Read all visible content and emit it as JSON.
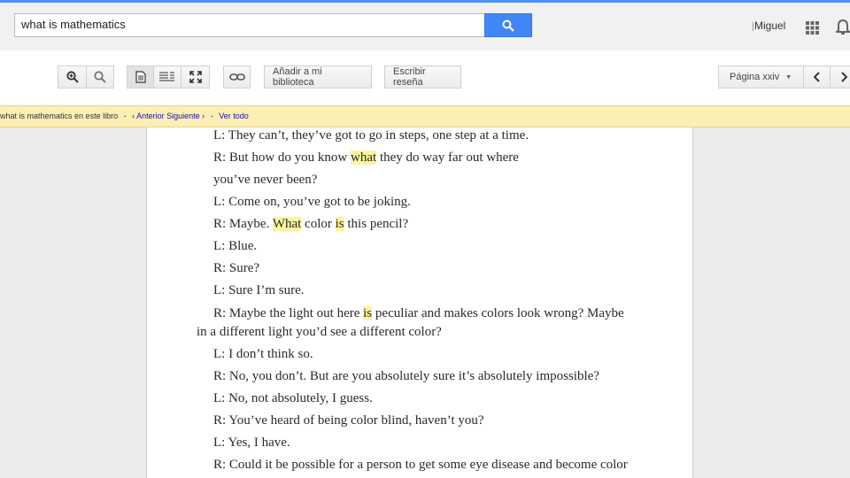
{
  "search": {
    "query": "what is mathematics"
  },
  "header": {
    "user_name": "Miguel"
  },
  "toolbar": {
    "add_library_label": "Añadir a mi biblioteca",
    "write_review_label": "Escribir reseña",
    "page_label": "Página xxiv"
  },
  "find_bar": {
    "query": "what is mathematics",
    "in_book": "en este libro",
    "dash": "-",
    "prev": "‹ Anterior",
    "next": "Siguiente ›",
    "view_all": "Ver todo"
  },
  "book": {
    "lines": [
      [
        {
          "t": "L: They can’t, they’ve got to go in steps, one step at a time."
        }
      ],
      [
        {
          "t": "R: But how do you know "
        },
        {
          "t": "what",
          "h": true
        },
        {
          "t": " they do way far out where"
        }
      ],
      [
        {
          "t": "you’ve never been?"
        }
      ],
      [
        {
          "t": "L: Come on, you’ve got to be joking."
        }
      ],
      [
        {
          "t": "R: Maybe. "
        },
        {
          "t": "What",
          "h": true
        },
        {
          "t": " color "
        },
        {
          "t": "is",
          "h": true
        },
        {
          "t": " this pencil?"
        }
      ],
      [
        {
          "t": "L: Blue."
        }
      ],
      [
        {
          "t": "R: Sure?"
        }
      ],
      [
        {
          "t": "L: Sure I’m sure."
        }
      ],
      [
        {
          "t": "R: Maybe the light out here "
        },
        {
          "t": "is",
          "h": true
        },
        {
          "t": " peculiar and makes colors look wrong? Maybe"
        }
      ],
      [
        {
          "t": "in a different light you’d see a different color?"
        }
      ],
      [
        {
          "t": "L: I don’t think so."
        }
      ],
      [
        {
          "t": "R: No, you don’t. But are you absolutely sure it’s absolutely impossible?"
        }
      ],
      [
        {
          "t": "L: No, not absolutely, I guess."
        }
      ],
      [
        {
          "t": "R: You’ve heard of being color blind, haven’t you?"
        }
      ],
      [
        {
          "t": "L: Yes, I have."
        }
      ],
      [
        {
          "t": "R: Could it be possible for a person to get some eye disease and become color"
        }
      ]
    ]
  },
  "colors": {
    "accent": "#4285f4",
    "find_bar": "#fbefb5",
    "highlight": "#fbf59c"
  }
}
